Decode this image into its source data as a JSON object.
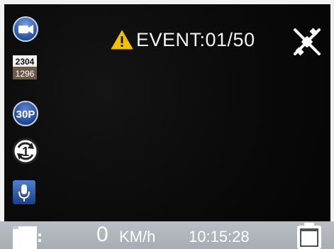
{
  "resolution": {
    "width_label": "2304",
    "height_label": "1296"
  },
  "framerate": {
    "label": "30P"
  },
  "loop": {
    "label": "1"
  },
  "event": {
    "label": "EVENT:01/50"
  },
  "status": {
    "speed_value": "0",
    "speed_unit": "KM/h",
    "time": "10:15:28"
  },
  "icons": {
    "video_mode": "video-camera-icon",
    "loop_record": "loop-recording-icon",
    "microphone": "microphone-icon",
    "warning": "warning-icon",
    "gps": "gps-satellite-off-icon",
    "sd_card": "sd-card-icon",
    "battery": "battery-icon"
  },
  "colors": {
    "accent_blue": "#2e5fb0",
    "warning_yellow": "#f2c200",
    "status_bar": "#b0b6bc"
  }
}
